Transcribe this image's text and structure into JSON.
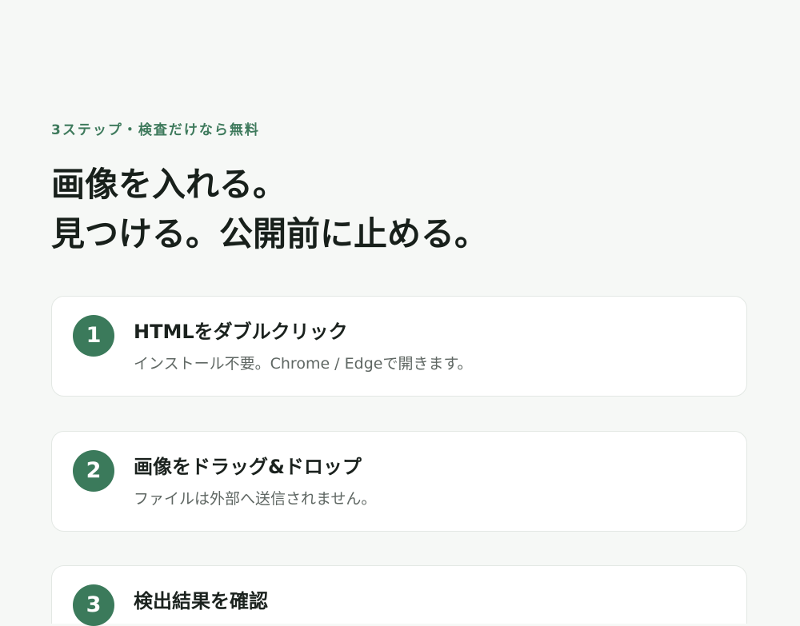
{
  "eyebrow": "3ステップ・検査だけなら無料",
  "headline": {
    "line1": "画像を入れる。",
    "line2": "見つける。公開前に止める。"
  },
  "steps": [
    {
      "number": "1",
      "title": "HTMLをダブルクリック",
      "description": "インストール不要。Chrome / Edgeで開きます。"
    },
    {
      "number": "2",
      "title": "画像をドラッグ&ドロップ",
      "description": "ファイルは外部へ送信されません。"
    },
    {
      "number": "3",
      "title": "検出結果を確認",
      "description": ""
    }
  ],
  "colors": {
    "accent": "#3b7a5b",
    "background": "#f6f8f6",
    "card": "#ffffff"
  }
}
